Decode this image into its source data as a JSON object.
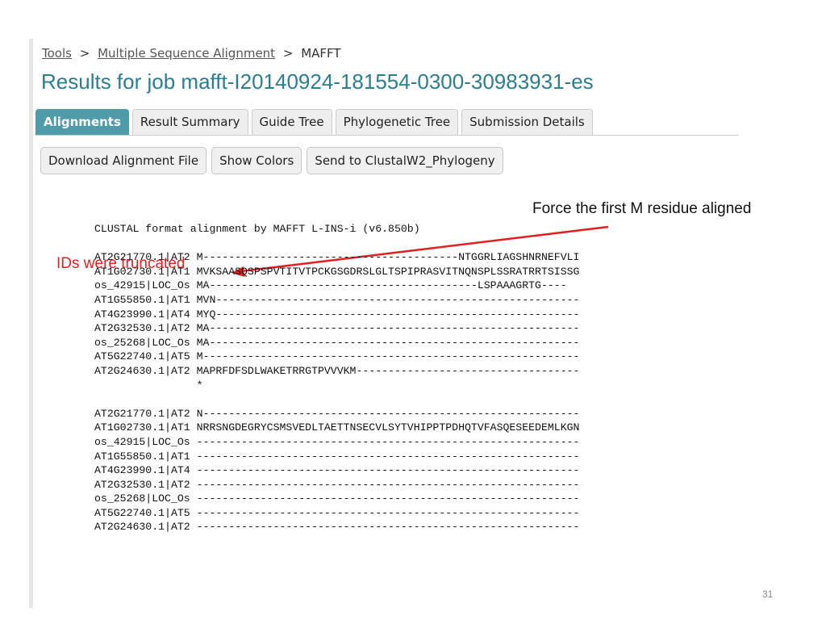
{
  "breadcrumb": {
    "items": [
      {
        "label": "Tools",
        "link": true
      },
      {
        "label": "Multiple Sequence Alignment",
        "link": true
      },
      {
        "label": "MAFFT",
        "link": false
      }
    ],
    "separator": ">"
  },
  "page_title": "Results for job mafft-I20140924-181554-0300-30983931-es",
  "tabs": [
    {
      "label": "Alignments",
      "active": true
    },
    {
      "label": "Result Summary",
      "active": false
    },
    {
      "label": "Guide Tree",
      "active": false
    },
    {
      "label": "Phylogenetic Tree",
      "active": false
    },
    {
      "label": "Submission Details",
      "active": false
    }
  ],
  "buttons": [
    {
      "label": "Download Alignment File"
    },
    {
      "label": "Show Colors"
    },
    {
      "label": "Send to ClustalW2_Phylogeny"
    }
  ],
  "annotations": {
    "force_note": "Force the first M residue aligned",
    "ids_note": "IDs were truncated"
  },
  "alignment": {
    "header": "CLUSTAL format alignment by MAFFT L-INS-i (v6.850b)",
    "blocks": [
      [
        "AT2G21770.1|AT2 M----------------------------------------NTGGRLIAGSHNRNEFVLI",
        "AT1G02730.1|AT1 MVKSAASQSPSPVTITVTPCKGSGDRSLGLTSPIPRASVITNQNSPLSSRATRRTSISSG",
        "os_42915|LOC_Os MA------------------------------------------LSPAAAGRTG----",
        "AT1G55850.1|AT1 MVN---------------------------------------------------------",
        "AT4G23990.1|AT4 MYQ---------------------------------------------------------",
        "AT2G32530.1|AT2 MA----------------------------------------------------------",
        "os_25268|LOC_Os MA----------------------------------------------------------",
        "AT5G22740.1|AT5 M-----------------------------------------------------------",
        "AT2G24630.1|AT2 MAPRFDFSDLWAKETRRGTPVVVKM-----------------------------------",
        "                *"
      ],
      [
        "AT2G21770.1|AT2 N-----------------------------------------------------------",
        "AT1G02730.1|AT1 NRRSNGDEGRYCSMSVEDLTAETTNSECVLSYTVHIPPTPDHQTVFASQESEEDEMLKGN",
        "os_42915|LOC_Os ------------------------------------------------------------",
        "AT1G55850.1|AT1 ------------------------------------------------------------",
        "AT4G23990.1|AT4 ------------------------------------------------------------",
        "AT2G32530.1|AT2 ------------------------------------------------------------",
        "os_25268|LOC_Os ------------------------------------------------------------",
        "AT5G22740.1|AT5 ------------------------------------------------------------",
        "AT2G24630.1|AT2 ------------------------------------------------------------"
      ]
    ]
  },
  "slide_number": "31",
  "colors": {
    "title": "#2c7e8e",
    "active_tab": "#4f9baa",
    "annotation_red": "#e02020"
  }
}
